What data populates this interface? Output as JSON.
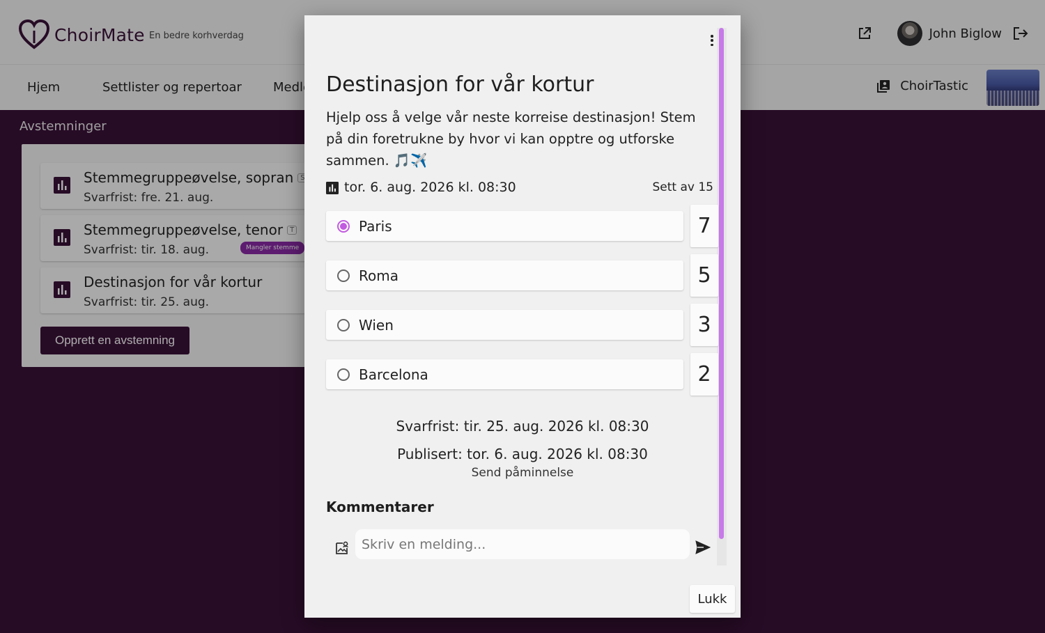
{
  "app": {
    "name": "ChoirMate",
    "tagline": "En bedre korhverdag",
    "user_name": "John Biglow",
    "icons": {
      "logo": "heart-logo-icon",
      "external": "open-external-icon",
      "logout": "logout-icon",
      "choir": "library-books-icon"
    }
  },
  "nav": {
    "items": [
      {
        "label": "Hjem"
      },
      {
        "label": "Settlister og repertoar"
      },
      {
        "label": "Medle"
      }
    ],
    "choir_name": "ChoirTastic"
  },
  "polls_section": {
    "title": "Avstemninger",
    "polls": [
      {
        "title": "Stemmegruppeøvelse, sopran",
        "tag": "S",
        "deadline": "Svarfrist: fre. 21. aug.",
        "badge": ""
      },
      {
        "title": "Stemmegruppeøvelse, tenor",
        "tag": "T",
        "deadline": "Svarfrist: tir. 18. aug.",
        "badge": "Mangler stemme"
      },
      {
        "title": "Destinasjon for vår kortur",
        "tag": "",
        "deadline": "Svarfrist: tir. 25. aug.",
        "badge": ""
      }
    ],
    "create_label": "Opprett en avstemning"
  },
  "dialog": {
    "title": "Destinasjon for vår kortur",
    "description": "Hjelp oss å velge vår neste korreise destinasjon! Stem på din foretrukne by hvor vi kan opptre og utforske sammen. 🎵✈️",
    "date": "tor. 6. aug. 2026 kl. 08:30",
    "seen_by": "Sett av 15",
    "options": [
      {
        "label": "Paris",
        "votes": "7",
        "selected": true
      },
      {
        "label": "Roma",
        "votes": "5",
        "selected": false
      },
      {
        "label": "Wien",
        "votes": "3",
        "selected": false
      },
      {
        "label": "Barcelona",
        "votes": "2",
        "selected": false
      }
    ],
    "deadline": "Svarfrist: tir. 25. aug. 2026 kl. 08:30",
    "published": "Publisert: tor. 6. aug. 2026 kl. 08:30",
    "reminder": "Send påminnelse",
    "comments_title": "Kommentarer",
    "message_placeholder": "Skriv en melding...",
    "close_label": "Lukk",
    "colors": {
      "accent": "#c25be0",
      "brand": "#3a1238"
    }
  }
}
